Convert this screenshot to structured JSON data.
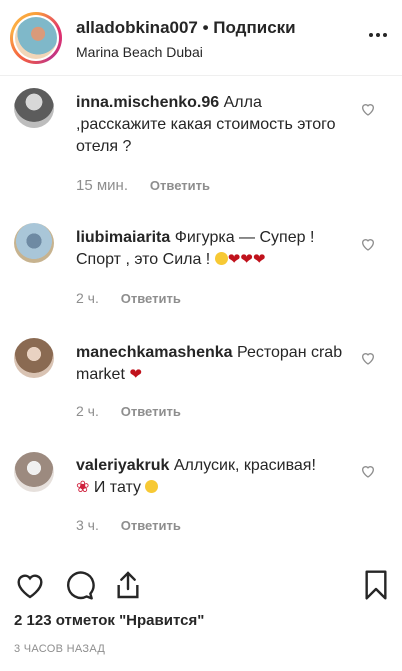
{
  "header": {
    "username": "alladobkina007",
    "follow_label": "• Подписки",
    "location": "Marina Beach Dubai"
  },
  "comments": [
    {
      "user": "inna.mischenko.96",
      "text": "Алла ,расскажите какая стоимость этого отеля ?",
      "time": "15 мин.",
      "reply": "Ответить"
    },
    {
      "user": "liubimaiarita",
      "text": "Фигурка — Супер ! Спорт , это Сила !",
      "time": "2 ч.",
      "reply": "Ответить"
    },
    {
      "user": "manechkamashenka",
      "text": "Ресторан crab market",
      "time": "2 ч.",
      "reply": "Ответить"
    },
    {
      "user": "valeriyakruk",
      "text": "Аллусик, красивая!",
      "text2": "И тату",
      "time": "3 ч.",
      "reply": "Ответить"
    }
  ],
  "likes_text": "2 123 отметок \"Нравится\"",
  "posted_ago": "3 ЧАСОВ НАЗАД",
  "icons": {
    "more": "more-icon",
    "heart": "heart-icon",
    "comment": "comment-icon",
    "share": "share-icon",
    "bookmark": "bookmark-icon"
  }
}
